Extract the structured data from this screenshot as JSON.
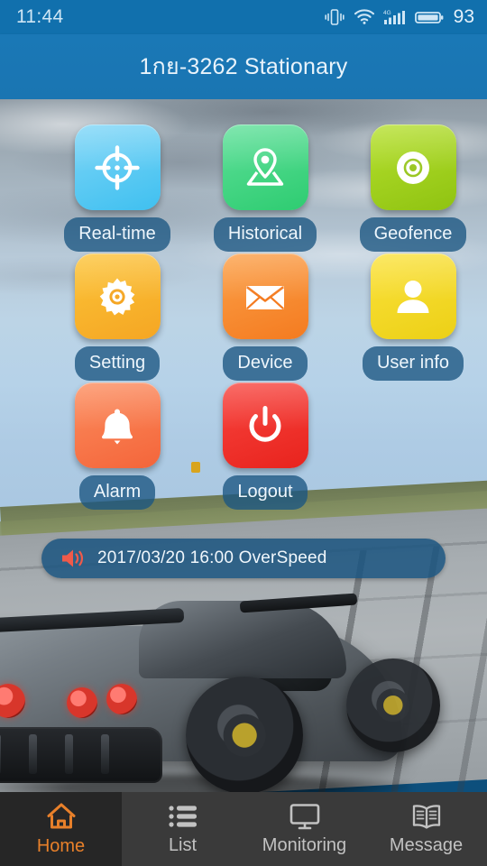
{
  "status_bar": {
    "time": "11:44",
    "battery_percent": "93",
    "icons": [
      "vibrate-icon",
      "wifi-icon",
      "signal-4g-icon",
      "battery-icon"
    ]
  },
  "header": {
    "title": "1กย-3262 Stationary"
  },
  "app_grid": {
    "rows": [
      [
        {
          "label": "Real-time",
          "icon": "crosshair-icon",
          "color_start": "#7fd6f7",
          "color_end": "#3fc0f0"
        },
        {
          "label": "Historical",
          "icon": "map-pin-icon",
          "color_start": "#5fe09a",
          "color_end": "#2ecc71"
        },
        {
          "label": "Geofence",
          "icon": "geofence-icon",
          "color_start": "#b6e02e",
          "color_end": "#8fc311"
        }
      ],
      [
        {
          "label": "Setting",
          "icon": "gear-icon",
          "color_start": "#fcc438",
          "color_end": "#f5a623"
        },
        {
          "label": "Device",
          "icon": "envelope-icon",
          "color_start": "#fba048",
          "color_end": "#f47b20"
        },
        {
          "label": "User info",
          "icon": "user-icon",
          "color_start": "#fbe23c",
          "color_end": "#ecd016"
        }
      ],
      [
        {
          "label": "Alarm",
          "icon": "bell-icon",
          "color_start": "#fc8d5e",
          "color_end": "#f4653a"
        },
        {
          "label": "Logout",
          "icon": "power-icon",
          "color_start": "#f8453f",
          "color_end": "#e8231d"
        }
      ]
    ]
  },
  "alert": {
    "icon": "speaker-alert-icon",
    "text": "2017/03/20 16:00 OverSpeed",
    "icon_color": "#f05a4a"
  },
  "bottom_nav": {
    "active_color": "#e8802a",
    "items": [
      {
        "label": "Home",
        "icon": "home-icon",
        "active": true
      },
      {
        "label": "List",
        "icon": "list-icon",
        "active": false
      },
      {
        "label": "Monitoring",
        "icon": "monitor-icon",
        "active": false
      },
      {
        "label": "Message",
        "icon": "book-icon",
        "active": false
      }
    ]
  }
}
